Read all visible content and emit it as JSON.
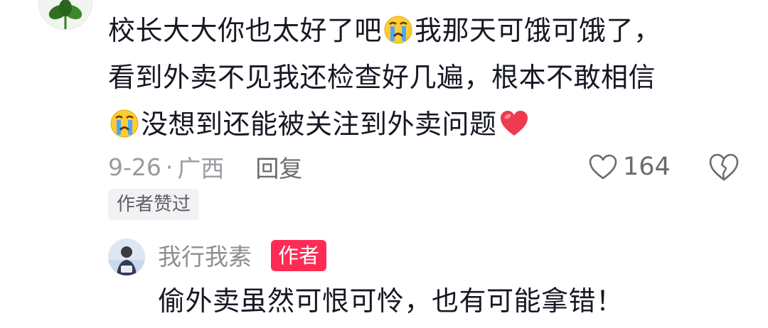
{
  "comment": {
    "lines": [
      {
        "before": "校长大大你也太好了吧",
        "emoji": "crying-face",
        "after": "我那天可饿可饿了，"
      },
      {
        "text": "看到外卖不见我还检查好几遍，根本不敢相信"
      },
      {
        "emoji": "crying-face",
        "text": "没想到还能被关注到外卖问题",
        "trailing_emoji": "red-heart"
      }
    ],
    "date": "9-26",
    "dot": "·",
    "location": "广西",
    "reply_label": "回复",
    "like_count": "164",
    "author_liked_badge": "作者赞过"
  },
  "reply": {
    "username": "我行我素",
    "author_tag": "作者",
    "text": "偷外卖虽然可恨可怜，也有可能拿错！"
  },
  "colors": {
    "text_primary": "#161823",
    "text_secondary": "#9a9aa0",
    "author_tag": "#fe2c55",
    "badge_bg": "#f2f2f4",
    "heart_red": "#f0394e"
  }
}
